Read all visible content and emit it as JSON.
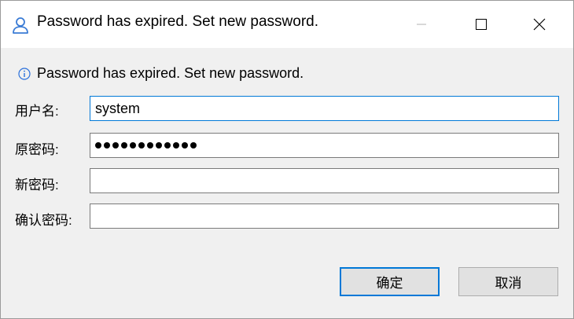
{
  "window": {
    "title": "Password has expired. Set new password.",
    "title_icon": "user-icon",
    "controls": {
      "minimize_icon": "minimize-icon",
      "maximize_icon": "maximize-icon",
      "close_icon": "close-icon"
    }
  },
  "info": {
    "icon": "info-icon",
    "message": "Password has expired. Set new password."
  },
  "form": {
    "username": {
      "label": "用户名:",
      "value": "system"
    },
    "old_password": {
      "label": "原密码:",
      "masked_length": 12
    },
    "new_password": {
      "label": "新密码:",
      "value": ""
    },
    "confirm_password": {
      "label": "确认密码:",
      "value": ""
    }
  },
  "buttons": {
    "ok_label": "确定",
    "cancel_label": "取消"
  },
  "colors": {
    "accent": "#0078d7",
    "title_icon": "#3a7bd5",
    "info_icon": "#2a6fdb",
    "dialog_background": "#f0f0f0",
    "button_background": "#e1e1e1"
  }
}
